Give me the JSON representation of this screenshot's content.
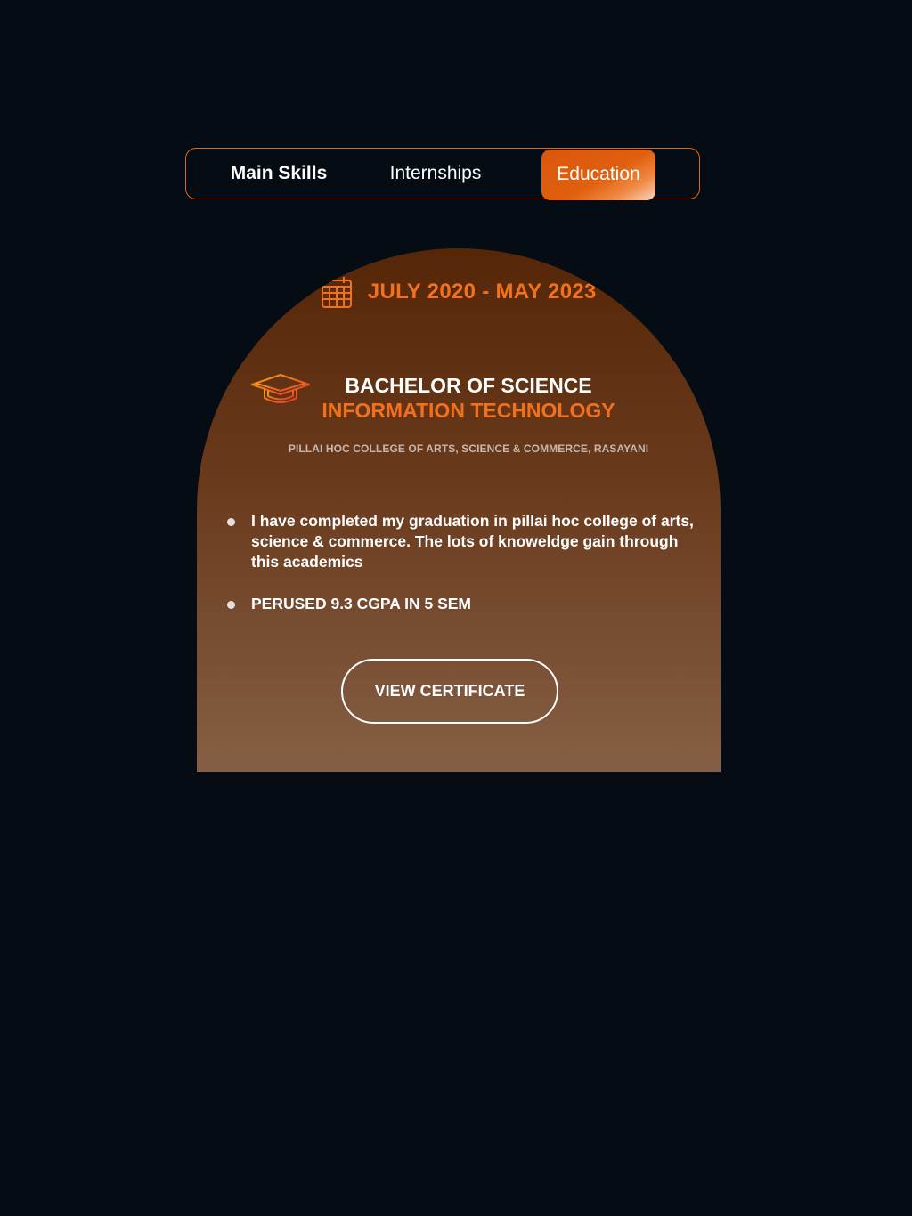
{
  "tabs": {
    "main_skills": "Main Skills",
    "internships": "Internships",
    "education": "Education",
    "active": "Education"
  },
  "education": {
    "date_range": "JULY 2020 - MAY 2023",
    "degree": "BACHELOR OF SCIENCE",
    "field": "INFORMATION TECHNOLOGY",
    "college": "PILLAI HOC COLLEGE OF ARTS, SCIENCE & COMMERCE, RASAYANI",
    "points": [
      "I have completed my graduation in pillai hoc college of arts, science & commerce. The lots of knoweldge gain through this academics",
      "PERUSED 9.3 CGPA IN 5 SEM"
    ],
    "button_label": "VIEW CERTIFICATE"
  },
  "icons": {
    "date": "calendar-icon",
    "degree": "graduation-cap-icon"
  },
  "colors": {
    "background": "#050c14",
    "accent": "#f2711c",
    "tab_border": "#e0661e",
    "card_top": "#552608",
    "card_bottom": "#855f45"
  }
}
